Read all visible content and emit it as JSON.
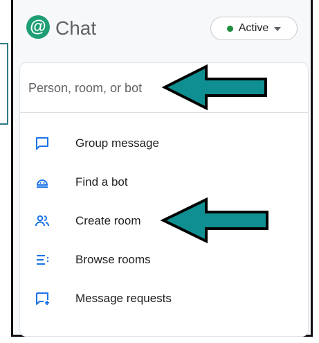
{
  "header": {
    "logo_glyph": "@",
    "title": "Chat",
    "status": {
      "label": "Active",
      "dot_color": "#1e8e3e"
    }
  },
  "search": {
    "placeholder": "Person, room, or bot"
  },
  "menu": {
    "items": [
      {
        "label": "Group message",
        "icon": "chat-bubble-icon"
      },
      {
        "label": "Find a bot",
        "icon": "bot-icon"
      },
      {
        "label": "Create room",
        "icon": "people-icon"
      },
      {
        "label": "Browse rooms",
        "icon": "list-icon"
      },
      {
        "label": "Message requests",
        "icon": "message-add-icon"
      }
    ]
  },
  "colors": {
    "accent": "#1a73e8",
    "arrow": "#0f8f91",
    "logo": "#1e9e74"
  }
}
